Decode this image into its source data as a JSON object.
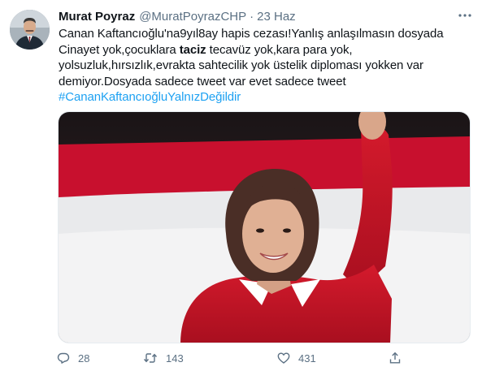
{
  "tweet": {
    "author": {
      "display_name": "Murat Poyraz",
      "handle": "@MuratPoyrazCHP",
      "separator": "·",
      "time": "23 Haz"
    },
    "lines": [
      {
        "parts": [
          {
            "text": "Canan Kaftancıoğlu'na9yıl8ay hapis cezası!Yanlış anlaşılmasın dosyada",
            "bold": false
          }
        ]
      },
      {
        "parts": [
          {
            "text": "Cinayet yok,çocuklara ",
            "bold": false
          },
          {
            "text": "taciz",
            "bold": true
          },
          {
            "text": " tecavüz yok,kara para yok,",
            "bold": false
          }
        ]
      },
      {
        "parts": [
          {
            "text": "yolsuzluk,hırsızlık,evrakta sahtecilik yok üstelik diploması yokken var",
            "bold": false
          }
        ]
      },
      {
        "parts": [
          {
            "text": "demiyor.Dosyada sadece tweet var evet sadece tweet",
            "bold": false
          }
        ]
      }
    ],
    "hashtag": "#CananKaftancıoğluYalnızDeğildir",
    "actions": {
      "replies": "28",
      "retweets": "143",
      "likes": "431"
    }
  },
  "icons": {
    "more": "more-horizontal-icon",
    "reply": "reply-icon",
    "retweet": "retweet-icon",
    "like": "heart-icon",
    "share": "share-icon"
  },
  "colors": {
    "accent": "#1da1f2",
    "secondary_text": "#5b7083",
    "primary_text": "#0f1419",
    "photo_red": "#c8102e"
  }
}
